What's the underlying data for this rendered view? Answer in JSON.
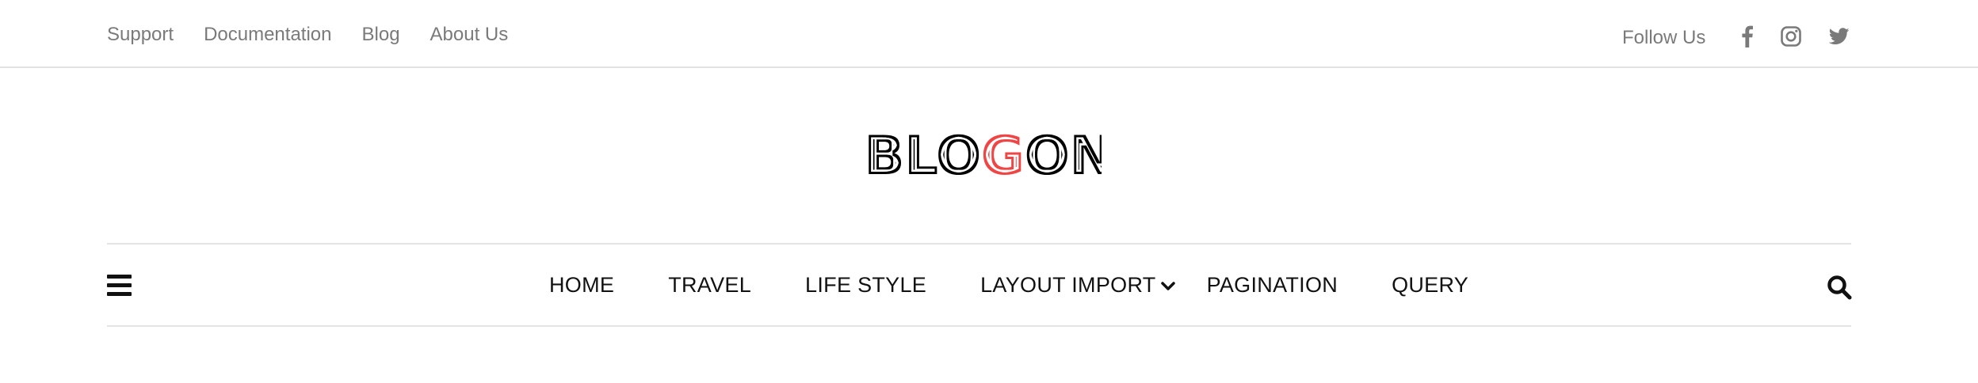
{
  "topbar": {
    "links": [
      "Support",
      "Documentation",
      "Blog",
      "About Us"
    ],
    "follow_label": "Follow Us",
    "social": [
      "facebook-icon",
      "instagram-icon",
      "twitter-icon"
    ]
  },
  "logo": {
    "text_part1": "BLO",
    "text_accent": "G",
    "text_part2": "ON",
    "accent_color": "#ef4444"
  },
  "nav": {
    "items": [
      "HOME",
      "TRAVEL",
      "LIFE STYLE",
      "LAYOUT IMPORT",
      "PAGINATION",
      "QUERY"
    ],
    "dropdown_item_index": 3,
    "menu_icon": "hamburger-menu-icon",
    "search_icon": "search-icon"
  }
}
